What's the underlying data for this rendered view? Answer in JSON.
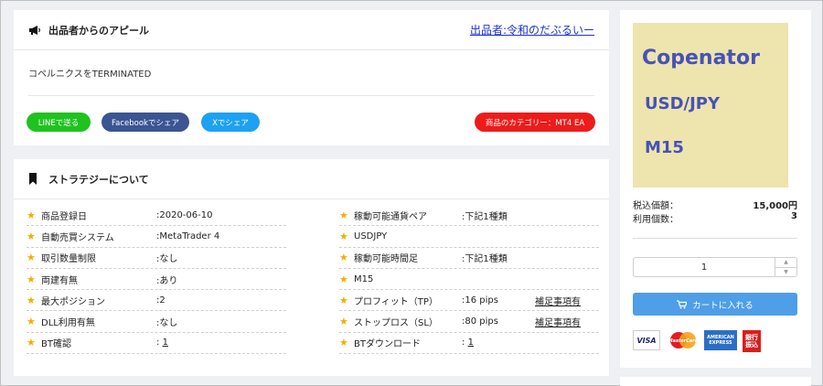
{
  "appeal": {
    "title": "出品者からのアピール",
    "seller_link": "出品者:令和のだぶるいー",
    "text": "コペルニクスをTERMINATED",
    "share_line": "LINEで送る",
    "share_facebook": "Facebookでシェア",
    "share_x": "Xでシェア",
    "category": "商品のカテゴリー：MT4 EA",
    "icon": "megaphone-icon"
  },
  "strategy": {
    "title": "ストラテジーについて",
    "icon": "bookmark-icon",
    "left": [
      {
        "label": "商品登録日",
        "value": ":2020-06-10"
      },
      {
        "label": "自動売買システム",
        "value": ":MetaTrader 4"
      },
      {
        "label": "取引数量制限",
        "value": ":なし"
      },
      {
        "label": "両建有無",
        "value": ":あり"
      },
      {
        "label": "最大ポジション",
        "value": ":2"
      },
      {
        "label": "DLL利用有無",
        "value": ":なし"
      },
      {
        "label": "BT確認",
        "value_prefix": ": ",
        "value_link": "1"
      }
    ],
    "right": [
      {
        "label": "稼動可能通貨ペア",
        "value": ":下記1種類"
      },
      {
        "label": "USDJPY",
        "value": ""
      },
      {
        "label": "稼動可能時間足",
        "value": ":下記1種類"
      },
      {
        "label": "M15",
        "value": ""
      },
      {
        "label": "プロフィット（TP）",
        "value": ":16 pips",
        "extra": "補足事項有"
      },
      {
        "label": "ストップロス（SL）",
        "value": ":80 pips",
        "extra": "補足事項有"
      },
      {
        "label": "BTダウンロード",
        "value_prefix": ": ",
        "value_link": "1"
      }
    ]
  },
  "product": {
    "image_lines": [
      "Copenator",
      "USD/JPY",
      "M15"
    ],
    "price_label": "税込価額：",
    "price_value": "15,000円",
    "count_label": "利用個数：",
    "count_value": "3",
    "quantity": "1",
    "cart_button": "カートに入れる",
    "payments": {
      "visa": "VISA",
      "master": "MasterCard",
      "amex_1": "AMERICAN",
      "amex_2": "EXPRESS",
      "bank_1": "銀行",
      "bank_2": "振込"
    }
  },
  "colors": {
    "line": "#1fc31f",
    "facebook": "#3a5591",
    "x": "#1da1f2",
    "category": "#ee1b1b",
    "cart_button": "#4e9ee8",
    "star": "#f0b000",
    "product_bg": "#eee4ad",
    "product_text": "#4652b8"
  }
}
